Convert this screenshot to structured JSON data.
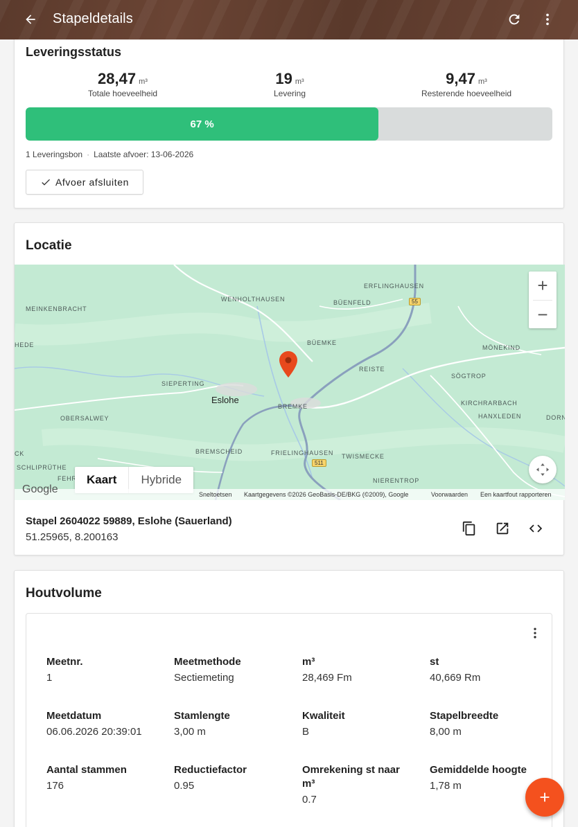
{
  "appbar": {
    "title": "Stapeldetails"
  },
  "levering": {
    "heading": "Leveringsstatus",
    "stats": [
      {
        "value": "28,47",
        "unit": "m³",
        "label": "Totale hoeveelheid"
      },
      {
        "value": "19",
        "unit": "m³",
        "label": "Levering"
      },
      {
        "value": "9,47",
        "unit": "m³",
        "label": "Resterende hoeveelheid"
      }
    ],
    "progress_label": "67 %",
    "progress_percent": 67,
    "meta_count": "1 Leveringsbon",
    "meta_last": "Laatste afvoer: 13-06-2026",
    "close_button": "Afvoer afsluiten"
  },
  "locatie": {
    "heading": "Locatie",
    "map": {
      "places": [
        "ERFLINGHAUSEN",
        "WENHOLTHAUSEN",
        "BÜENFELD",
        "MEINKENBRACHT",
        "HEDE",
        "BÜEMKE",
        "MÖNEKIND",
        "REISTE",
        "SÖGTROP",
        "SIEPERTING",
        "BREMKE",
        "KIRCHRARBACH",
        "OBERSALWEY",
        "HANXLEDEN",
        "DORN",
        "CK",
        "BREMSCHEID",
        "FRIELINGHAUSEN",
        "TWISMECKE",
        "SCHLIPRÜTHE",
        "FEHR",
        "NIERENTROP"
      ],
      "town": "Eslohe",
      "road_55": "55",
      "road_511": "511",
      "type_map": "Kaart",
      "type_hybrid": "Hybride",
      "google": "Google",
      "attribution": [
        "Sneltoetsen",
        "Kaartgegevens ©2026 GeoBasis-DE/BKG (©2009), Google",
        "Voorwaarden",
        "Een kaartfout rapporteren"
      ],
      "zoom_in": "+",
      "zoom_out": "−"
    },
    "title": "Stapel 2604022 59889, Eslohe (Sauerland)",
    "coords": "51.25965, 8.200163"
  },
  "houtvolume": {
    "heading": "Houtvolume",
    "fields": [
      {
        "key": "Meetnr.",
        "value": "1"
      },
      {
        "key": "Meetmethode",
        "value": "Sectiemeting"
      },
      {
        "key": "m³",
        "value": "28,469 Fm"
      },
      {
        "key": "st",
        "value": "40,669 Rm"
      },
      {
        "key": "Meetdatum",
        "value": "06.06.2026 20:39:01"
      },
      {
        "key": "Stamlengte",
        "value": "3,00 m"
      },
      {
        "key": "Kwaliteit",
        "value": "B"
      },
      {
        "key": "Stapelbreedte",
        "value": "8,00 m"
      },
      {
        "key": "Aantal stammen",
        "value": "176"
      },
      {
        "key": "Reductiefactor",
        "value": "0.95"
      },
      {
        "key": "Omrekening st naar m³",
        "value": "0.7"
      },
      {
        "key": "Gemiddelde hoogte",
        "value": "1,78 m"
      }
    ]
  },
  "icons": {
    "back": "arrow-left-icon",
    "refresh": "refresh-icon",
    "more": "more-vert-icon",
    "check": "check-icon",
    "copy": "copy-icon",
    "open": "open-in-new-icon",
    "code": "code-icon",
    "pin": "map-pin-icon",
    "add": "plus-icon"
  },
  "colors": {
    "appbar": "#5b3a2c",
    "progress": "#2fbf7a",
    "fab": "#f4511e",
    "pin": "#e8491d"
  }
}
